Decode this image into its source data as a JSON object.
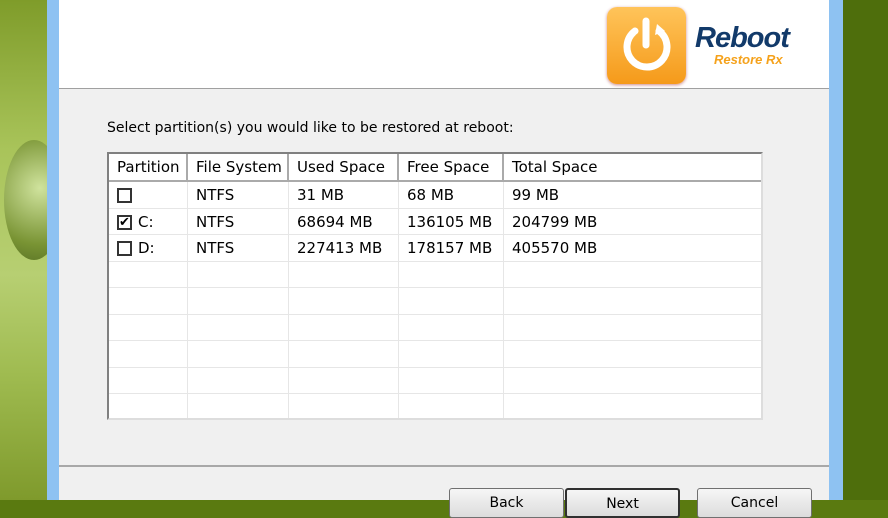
{
  "logo": {
    "title": "Reboot",
    "subtitle": "Restore Rx"
  },
  "prompt": "Select partition(s) you would like to be restored at reboot:",
  "table": {
    "columns": [
      "Partition",
      "File System",
      "Used Space",
      "Free Space",
      "Total Space"
    ],
    "rows": [
      {
        "checked": false,
        "partition": "",
        "fs": "NTFS",
        "used": "31 MB",
        "free": "68 MB",
        "total": "99 MB"
      },
      {
        "checked": true,
        "partition": "C:",
        "fs": "NTFS",
        "used": "68694 MB",
        "free": "136105 MB",
        "total": "204799 MB"
      },
      {
        "checked": false,
        "partition": "D:",
        "fs": "NTFS",
        "used": "227413 MB",
        "free": "178157 MB",
        "total": "405570 MB"
      }
    ]
  },
  "buttons": {
    "back": "Back",
    "next": "Next",
    "cancel": "Cancel"
  },
  "check_mark": "✔"
}
